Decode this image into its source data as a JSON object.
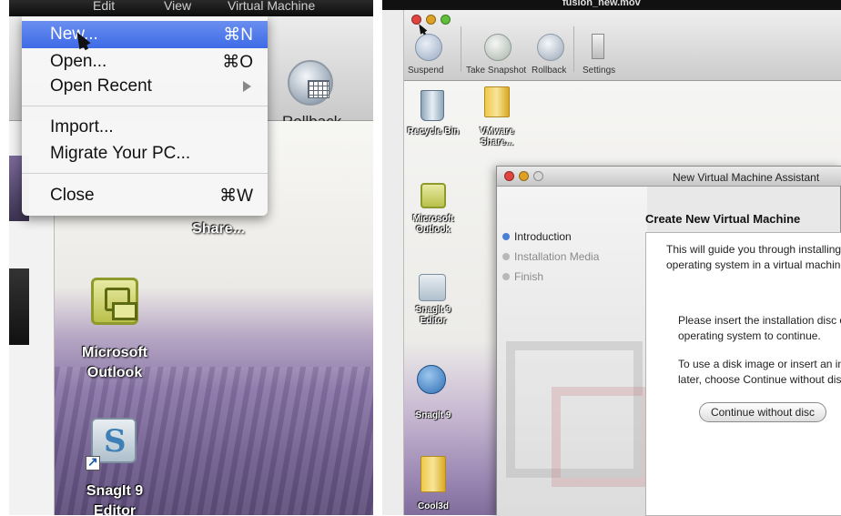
{
  "left": {
    "menubar_items": [
      "Edit",
      "View",
      "Virtual Machine"
    ],
    "file_menu": {
      "items": [
        {
          "label": "New...",
          "shortcut": "⌘N",
          "highlighted": true
        },
        {
          "label": "Open...",
          "shortcut": "⌘O"
        },
        {
          "label": "Open Recent",
          "has_submenu": true
        },
        {
          "label": "Import..."
        },
        {
          "label": "Migrate Your PC..."
        },
        {
          "label": "Close",
          "shortcut": "⌘W"
        }
      ]
    },
    "toolbar": {
      "rollback_label": "Rollback"
    },
    "desktop": {
      "share_label": "Share...",
      "outlook_label_line1": "Microsoft",
      "outlook_label_line2": "Outlook",
      "snagit_label_line1": "SnagIt 9",
      "snagit_label_line2": "Editor"
    },
    "highlight_color": "#4a76ea"
  },
  "right": {
    "topbar_title": "fusion_new.mov",
    "toolbar": {
      "suspend": "Suspend",
      "take_snapshot": "Take Snapshot",
      "rollback": "Rollback",
      "settings": "Settings"
    },
    "desktop": {
      "recycle_bin": "Recycle Bin",
      "vmware_share_line1": "VMware",
      "vmware_share_line2": "Share...",
      "outlook_line1": "Microsoft",
      "outlook_line2": "Outlook",
      "snagit_editor_line1": "SnagIt 9",
      "snagit_editor_line2": "Editor",
      "snagit": "SnagIt 9",
      "cool3d": "Cool3d"
    },
    "assistant": {
      "title": "New Virtual Machine Assistant",
      "steps": [
        "Introduction",
        "Installation Media",
        "Finish"
      ],
      "heading": "Create New Virtual Machine",
      "intro_line1": "This will guide you through installing",
      "intro_line2": "operating system in a virtual machine",
      "insert_line1": "Please insert the installation disc o",
      "insert_line2": "operating system to continue.",
      "image_line1": "To use a disk image or insert an in",
      "image_line2": "later, choose Continue without disc",
      "continue_button": "Continue without disc"
    }
  }
}
